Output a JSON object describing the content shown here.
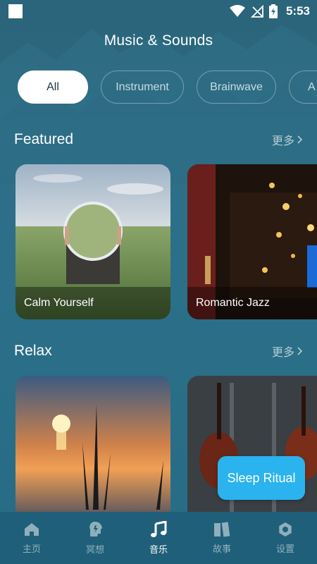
{
  "status_bar": {
    "time": "5:53"
  },
  "header": {
    "title": "Music & Sounds"
  },
  "filters": [
    {
      "label": "All",
      "active": true
    },
    {
      "label": "Instrument",
      "active": false
    },
    {
      "label": "Brainwave",
      "active": false
    },
    {
      "label": "A",
      "active": false
    }
  ],
  "featured": {
    "title": "Featured",
    "more": "更多",
    "cards": [
      {
        "label": "Calm Yourself"
      },
      {
        "label": "Romantic Jazz"
      }
    ]
  },
  "relax": {
    "title": "Relax",
    "more": "更多"
  },
  "floating_button": {
    "label": "Sleep Ritual"
  },
  "tab_bar": {
    "items": [
      {
        "label": "主页",
        "icon": "home-icon",
        "active": false
      },
      {
        "label": "冥想",
        "icon": "meditate-icon",
        "active": false
      },
      {
        "label": "音乐",
        "icon": "music-note-icon",
        "active": true
      },
      {
        "label": "故事",
        "icon": "book-icon",
        "active": false
      },
      {
        "label": "设置",
        "icon": "gear-icon",
        "active": false
      }
    ]
  },
  "colors": {
    "accent": "#2ab3ee",
    "background": "#2c6a80",
    "tab_bar": "#1f5f79"
  }
}
